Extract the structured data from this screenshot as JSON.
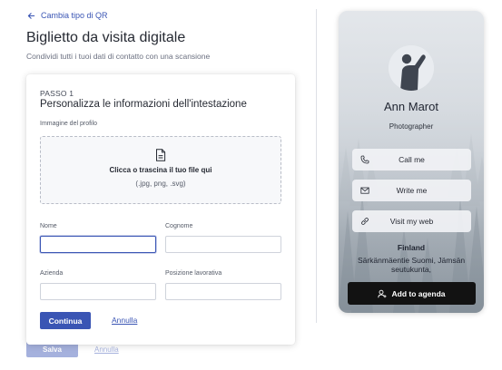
{
  "header": {
    "back_label": "Cambia tipo di QR",
    "title": "Biglietto da visita digitale",
    "subtitle": "Condividi tutti i tuoi dati di contatto con una scansione"
  },
  "form": {
    "step_label": "PASSO 1",
    "step_title": "Personalizza le informazioni dell'intestazione",
    "profile_image_label": "Immagine del profilo",
    "dropzone": {
      "icon": "file-icon",
      "main_text": "Clicca o trascina il tuo file qui",
      "hint_text": "(.jpg, png, .svg)"
    },
    "fields": {
      "first_name": {
        "label": "Nome",
        "value": "",
        "placeholder": ""
      },
      "last_name": {
        "label": "Cognome",
        "value": "",
        "placeholder": ""
      },
      "company": {
        "label": "Azienda",
        "value": "",
        "placeholder": ""
      },
      "job_title": {
        "label": "Posizione lavorativa",
        "value": "",
        "placeholder": ""
      }
    },
    "continue_label": "Continua",
    "cancel_label": "Annulla"
  },
  "background_buttons": {
    "save_label": "Salva",
    "cancel_label": "Annulla"
  },
  "preview": {
    "name": "Ann Marot",
    "role": "Photographer",
    "actions": [
      {
        "label": "Call me",
        "icon": "phone-icon"
      },
      {
        "label": "Write me",
        "icon": "mail-icon"
      },
      {
        "label": "Visit my web",
        "icon": "link-icon"
      }
    ],
    "country": "Finland",
    "address": "Särkänmäentie Suomi, Jämsän seutukunta,",
    "agenda_label": "Add to agenda",
    "agenda_icon": "add-contact-icon"
  },
  "colors": {
    "accent": "#3a55b4",
    "agenda_button": "#121212"
  }
}
